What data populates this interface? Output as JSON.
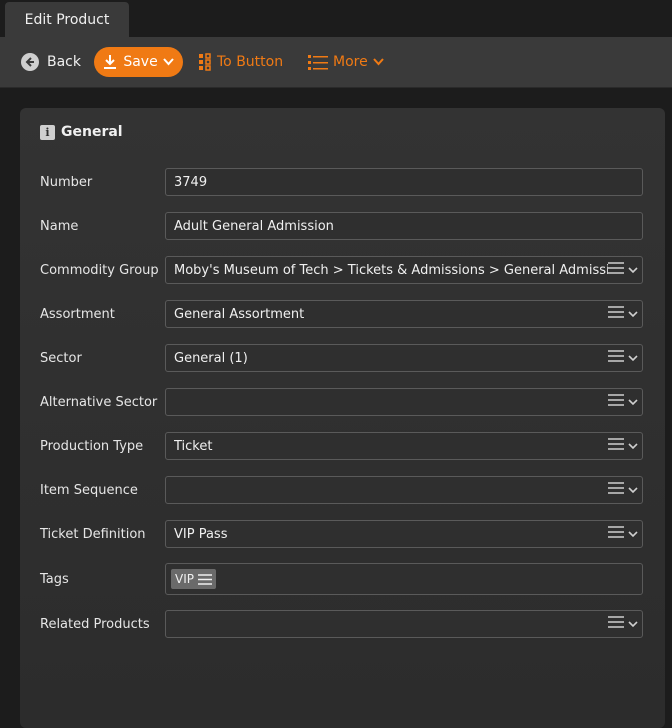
{
  "tab": {
    "title": "Edit Product"
  },
  "toolbar": {
    "back_label": "Back",
    "save_label": "Save",
    "to_button_label": "To Button",
    "more_label": "More"
  },
  "colors": {
    "accent": "#f07a14",
    "background": "#1c1c1c",
    "panel": "#2e2e2e"
  },
  "section": {
    "title": "General"
  },
  "form": {
    "number": {
      "label": "Number",
      "value": "3749"
    },
    "name": {
      "label": "Name",
      "value": "Adult General Admission"
    },
    "commodity_group": {
      "label": "Commodity Group",
      "value": "Moby's Museum of Tech > Tickets & Admissions > General Admission"
    },
    "assortment": {
      "label": "Assortment",
      "value": "General Assortment"
    },
    "sector": {
      "label": "Sector",
      "value": "General (1)"
    },
    "alternative_sector": {
      "label": "Alternative Sector",
      "value": ""
    },
    "production_type": {
      "label": "Production Type",
      "value": "Ticket"
    },
    "item_sequence": {
      "label": "Item Sequence",
      "value": ""
    },
    "ticket_definition": {
      "label": "Ticket Definition",
      "value": "VIP Pass"
    },
    "tags": {
      "label": "Tags",
      "items": [
        "VIP"
      ]
    },
    "related_products": {
      "label": "Related Products",
      "value": ""
    }
  }
}
